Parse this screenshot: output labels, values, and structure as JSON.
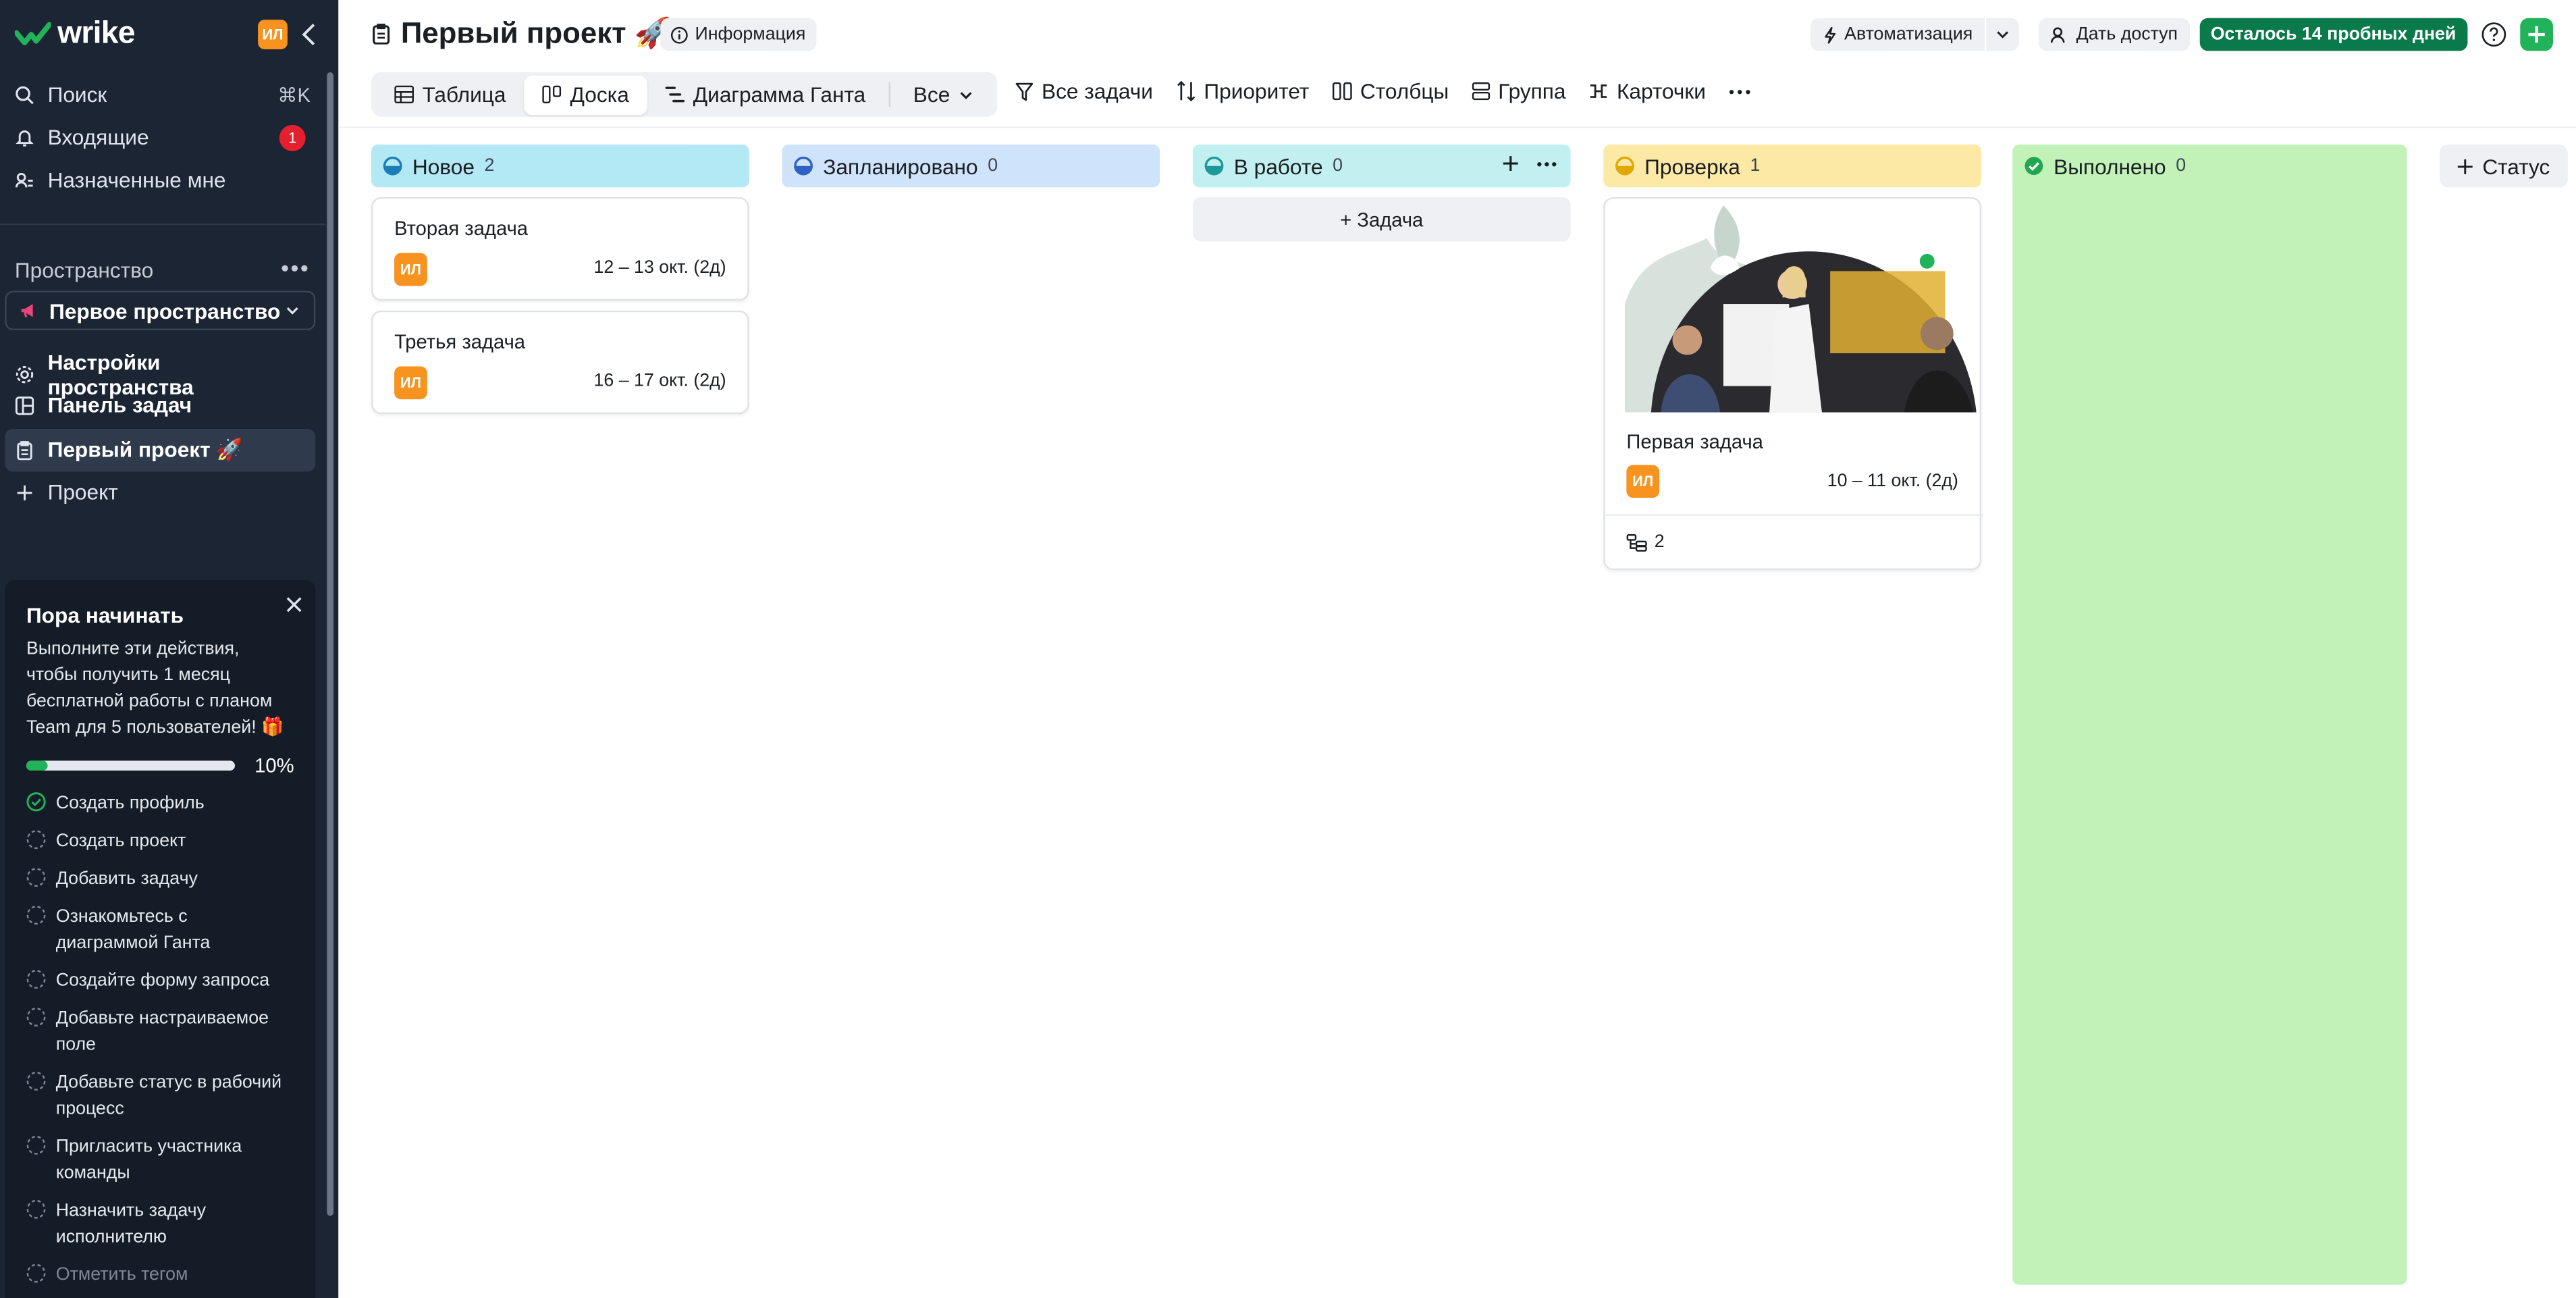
{
  "sidebar": {
    "logo_text": "wrike",
    "avatar_initials": "ИЛ",
    "search_label": "Поиск",
    "search_shortcut": "⌘K",
    "inbox_label": "Входящие",
    "inbox_badge": "1",
    "assigned_label": "Назначенные мне",
    "space_section_title": "Пространство",
    "space_name": "Первое пространство",
    "items": [
      {
        "label": "Настройки пространства",
        "icon": "gear-icon"
      },
      {
        "label": "Панель задач",
        "icon": "panel-icon"
      },
      {
        "label": "Первый проект 🚀",
        "icon": "clipboard-icon",
        "active": true
      },
      {
        "label": "Проект",
        "icon": "plus-icon"
      }
    ]
  },
  "onboarding": {
    "title": "Пора начинать",
    "description": "Выполните эти действия, чтобы получить 1 месяц бесплатной работы с планом Team для 5 пользователей! 🎁",
    "progress": 0.1,
    "progress_label": "10%",
    "steps": [
      {
        "label": "Создать профиль",
        "done": true
      },
      {
        "label": "Создать проект",
        "done": false
      },
      {
        "label": "Добавить задачу",
        "done": false
      },
      {
        "label": "Ознакомьтесь с диаграммой Ганта",
        "done": false
      },
      {
        "label": "Создайте форму запроса",
        "done": false
      },
      {
        "label": "Добавьте настраиваемое поле",
        "done": false
      },
      {
        "label": "Добавьте статус в рабочий процесс",
        "done": false
      },
      {
        "label": "Пригласить участника команды",
        "done": false
      },
      {
        "label": "Назначить задачу исполнителю",
        "done": false
      },
      {
        "label": "Отметить тегом",
        "done": false
      }
    ]
  },
  "header": {
    "project_title": "Первый проект 🚀",
    "info_label": "Информация",
    "automation_label": "Автоматизация",
    "share_label": "Дать доступ",
    "trial_label": "Осталось 14 пробных дней"
  },
  "views": {
    "tabs": [
      {
        "label": "Таблица",
        "icon": "table-icon"
      },
      {
        "label": "Доска",
        "icon": "board-icon",
        "active": true
      },
      {
        "label": "Диаграмма Ганта",
        "icon": "gantt-icon"
      }
    ],
    "all_label": "Все"
  },
  "tools": [
    {
      "label": "Все задачи",
      "icon": "filter-icon"
    },
    {
      "label": "Приоритет",
      "icon": "sort-icon"
    },
    {
      "label": "Столбцы",
      "icon": "columns-icon"
    },
    {
      "label": "Группа",
      "icon": "group-icon"
    },
    {
      "label": "Карточки",
      "icon": "cards-icon"
    }
  ],
  "board": {
    "columns": [
      {
        "name": "Новое",
        "count": "2",
        "color": "#b3e8f5"
      },
      {
        "name": "Запланировано",
        "count": "0",
        "color": "#cfe3fb"
      },
      {
        "name": "В работе",
        "count": "0",
        "color": "#c2f0f0"
      },
      {
        "name": "Проверка",
        "count": "1",
        "color": "#fde9a6"
      },
      {
        "name": "Выполнено",
        "count": "0",
        "color": "#c2f2b8"
      }
    ],
    "add_task_label": "+ Задача",
    "add_status_label": "Статус",
    "cards": [
      {
        "title": "Вторая задача",
        "assignee": "ИЛ",
        "dates": "12 – 13 окт. (2д)"
      },
      {
        "title": "Третья задача",
        "assignee": "ИЛ",
        "dates": "16 – 17 окт. (2д)"
      },
      {
        "title": "Первая задача",
        "assignee": "ИЛ",
        "dates": "10 – 11 окт. (2д)",
        "subtasks": "2"
      }
    ]
  },
  "colors": {
    "sidebar_bg": "#1b2533",
    "accent_green": "#21b35a",
    "trial_green": "#0b7a4a",
    "avatar_orange": "#f7931e"
  }
}
